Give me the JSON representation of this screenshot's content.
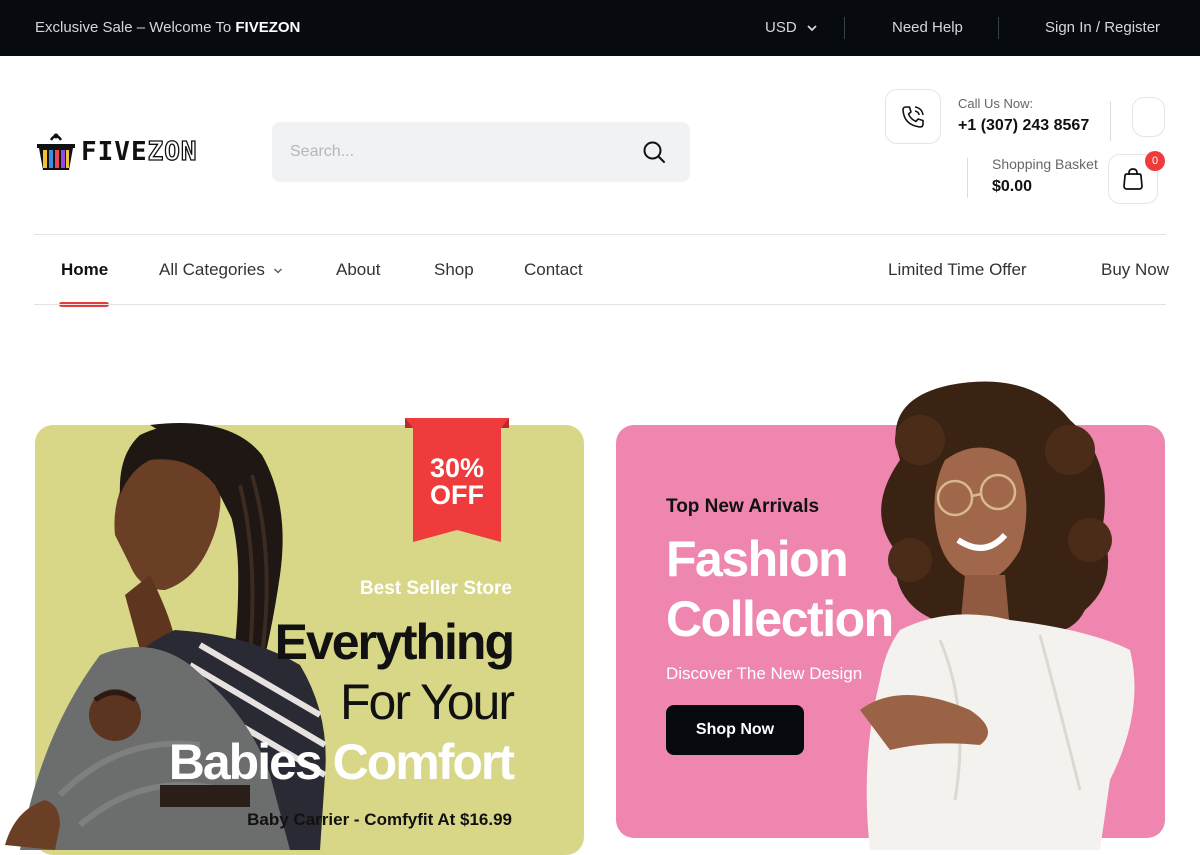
{
  "topbar": {
    "welcome_prefix": "Exclusive Sale – Welcome To ",
    "welcome_brand": "FIVEZON",
    "currency": "USD",
    "help": "Need Help",
    "signin": "Sign In / Register"
  },
  "header": {
    "logo_left": "FIVE",
    "logo_right": "ZON",
    "search_placeholder": "Search...",
    "call_label": "Call Us Now:",
    "call_number": "+1 (307) 243 8567",
    "basket_label": "Shopping Basket",
    "basket_total": "$0.00",
    "basket_count": "0"
  },
  "nav": {
    "items": [
      {
        "label": "Home",
        "active": true
      },
      {
        "label": "All Categories",
        "has_dropdown": true
      },
      {
        "label": "About"
      },
      {
        "label": "Shop"
      },
      {
        "label": "Contact"
      }
    ],
    "right": [
      "Limited Time Offer",
      "Buy Now"
    ]
  },
  "banner_left": {
    "ribbon_line1": "30%",
    "ribbon_line2": "OFF",
    "tag": "Best Seller Store",
    "line1": "Everything",
    "line2": "For Your",
    "line3": "Babies Comfort",
    "price_line": "Baby Carrier - Comfyfit At $16.99",
    "bg_color": "#d8d788",
    "ribbon_color": "#ef3b3b"
  },
  "banner_right": {
    "tag": "Top New Arrivals",
    "title_line1": "Fashion",
    "title_line2": "Collection",
    "subtitle": "Discover The New Design",
    "button": "Shop Now",
    "bg_color": "#ef86b0"
  },
  "icons": {
    "search": "search-icon",
    "phone": "phone-icon",
    "bag": "shopping-bag-icon",
    "chevron": "chevron-down-icon"
  }
}
